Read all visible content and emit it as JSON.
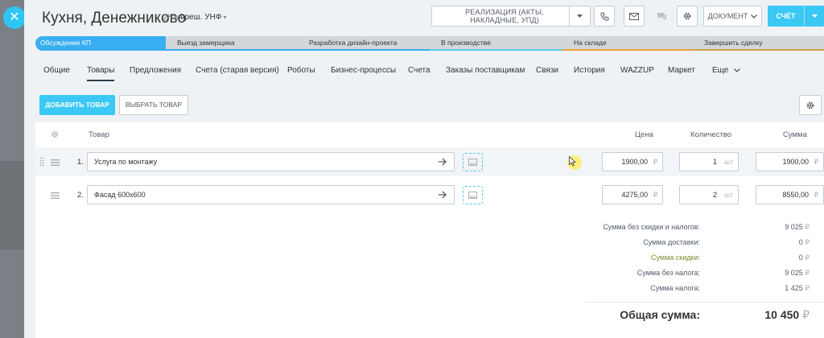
{
  "header": {
    "title": "Кухня, Денежниково",
    "pipeline": "Фреш. УНФ",
    "realize_label": "РЕАЛИЗАЦИЯ (АКТЫ, НАКЛАДНЫЕ, УПД)",
    "document_label": "ДОКУМЕНТ",
    "schet_label": "СЧЁТ"
  },
  "stages": [
    {
      "label": "Обсуждение КП",
      "color": "#39aef0"
    },
    {
      "label": "Выезд замерщика",
      "color": "#39aef0"
    },
    {
      "label": "Разработка дизайн-проекта",
      "color": "#39aef0"
    },
    {
      "label": "В производстве",
      "color": "#55d0e0"
    },
    {
      "label": "На складе",
      "color": "#f0a13a"
    },
    {
      "label": "Завершить сделку",
      "color": "#d3d7dc"
    }
  ],
  "tabs": [
    "Общие",
    "Товары",
    "Предложения",
    "Счета (старая версия)",
    "Роботы",
    "Бизнес-процессы",
    "Счета",
    "Заказы поставщикам",
    "Связи",
    "История",
    "WAZZUP",
    "Маркет",
    "Еще"
  ],
  "toolbar": {
    "add_label": "ДОБАВИТЬ ТОВАР",
    "pick_label": "ВЫБРАТЬ ТОВАР"
  },
  "table": {
    "col_product": "Товар",
    "col_price": "Цена",
    "col_qty": "Количество",
    "col_sum": "Сумма",
    "currency": "₽",
    "unit": "шт",
    "rows": [
      {
        "num": "1.",
        "name": "Услуга по монтажу",
        "price": "1900,00",
        "qty": "1",
        "sum": "1900,00"
      },
      {
        "num": "2.",
        "name": "Фасад 600x600",
        "price": "4275,00",
        "qty": "2",
        "sum": "8550,00"
      }
    ]
  },
  "totals": {
    "items": [
      {
        "label": "Сумма без скидки и налогов:",
        "value": "9 025"
      },
      {
        "label": "Сумма доставки:",
        "value": "0"
      },
      {
        "label": "Сумма скидки:",
        "value": "0"
      },
      {
        "label": "Сумма без налога:",
        "value": "9 025"
      },
      {
        "label": "Сумма налога:",
        "value": "1 425"
      }
    ],
    "grand_label": "Общая сумма:",
    "grand_value": "10 450"
  }
}
